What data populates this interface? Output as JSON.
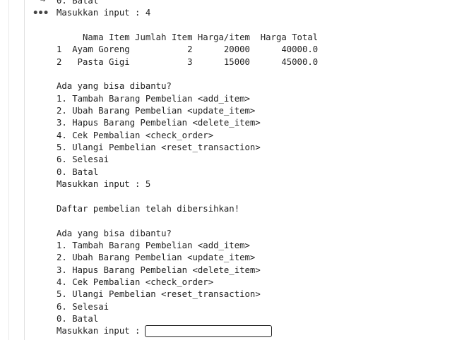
{
  "icons": {
    "more": "more-horiz-icon",
    "partial": "output-toggle-icon"
  },
  "output_lines": [
    "0. Batal",
    "Masukkan input : 4",
    "",
    "     Nama Item Jumlah Item Harga/item  Harga Total",
    "1  Ayam Goreng           2      20000      40000.0",
    "2   Pasta Gigi           3      15000      45000.0",
    "",
    "Ada yang bisa dibantu?",
    "1. Tambah Barang Pembelian <add_item>",
    "2. Ubah Barang Pembelian <update_item>",
    "3. Hapus Barang Pembelian <delete_item>",
    "4. Cek Pembalian <check_order>",
    "5. Ulangi Pembelian <reset_transaction>",
    "6. Selesai",
    "0. Batal",
    "Masukkan input : 5",
    "",
    "Daftar pembelian telah dibersihkan!",
    "",
    "Ada yang bisa dibantu?",
    "1. Tambah Barang Pembelian <add_item>",
    "2. Ubah Barang Pembelian <update_item>",
    "3. Hapus Barang Pembelian <delete_item>",
    "4. Cek Pembalian <check_order>",
    "5. Ulangi Pembelian <reset_transaction>",
    "6. Selesai",
    "0. Batal"
  ],
  "prompt": {
    "label": "Masukkan input :",
    "value": ""
  }
}
